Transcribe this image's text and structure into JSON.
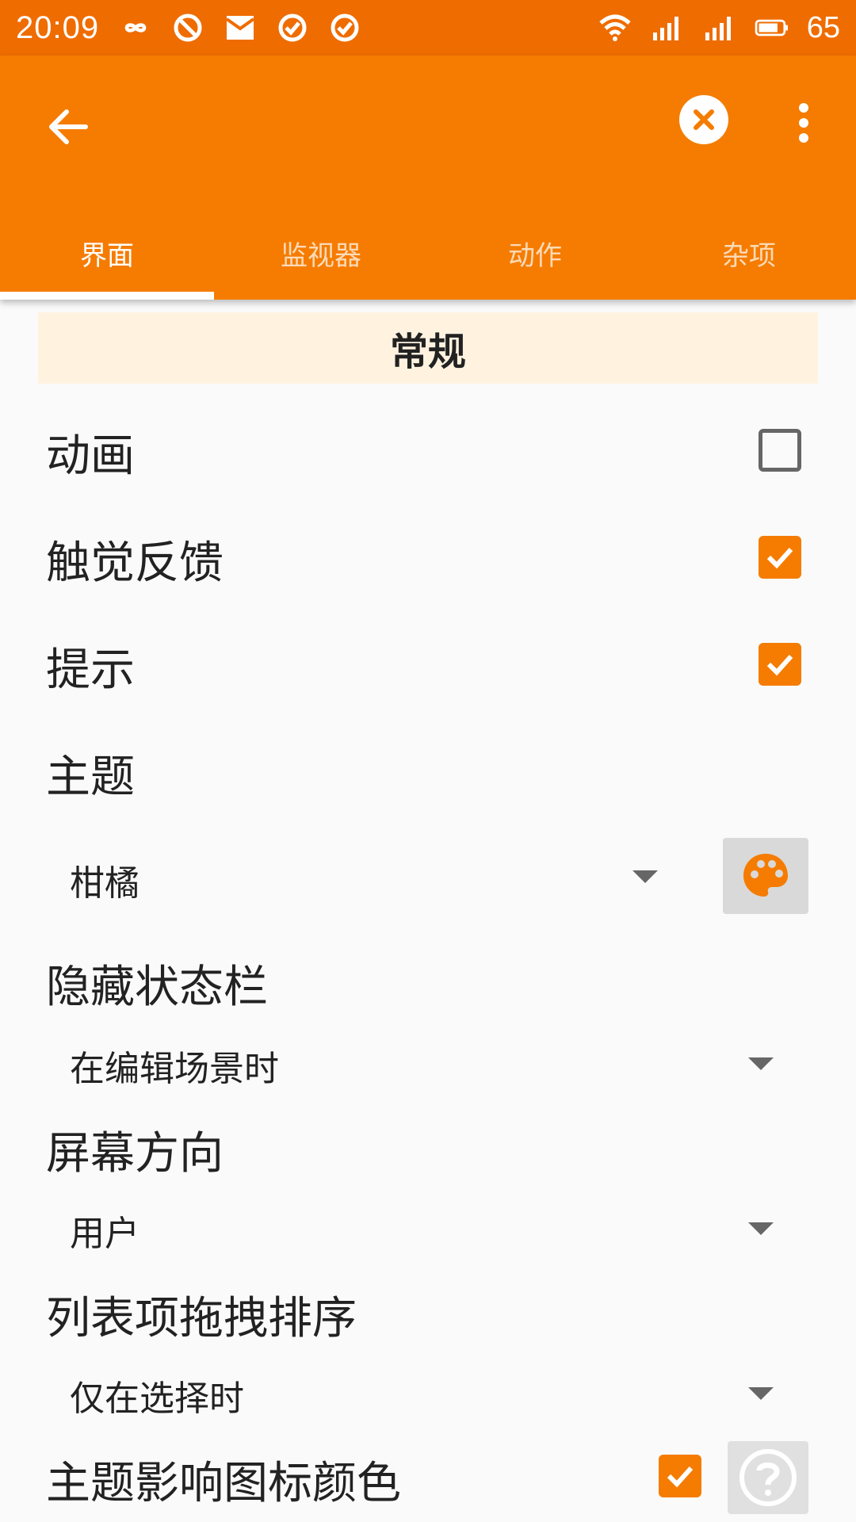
{
  "status_bar": {
    "time": "20:09",
    "left_icons": [
      "infinity-icon",
      "blocked-icon",
      "mail-icon",
      "check-circle-icon",
      "check-circle-icon"
    ],
    "right_icons": [
      "wifi-icon",
      "signal-4g-icon",
      "signal-icon",
      "battery-icon"
    ],
    "battery": "65"
  },
  "app_bar": {
    "back_icon": "arrow-back-icon",
    "close_icon": "close-circle-icon",
    "more_icon": "more-vert-icon",
    "tabs": [
      {
        "label": "界面",
        "active": true
      },
      {
        "label": "监视器",
        "active": false
      },
      {
        "label": "动作",
        "active": false
      },
      {
        "label": "杂项",
        "active": false
      }
    ]
  },
  "section": {
    "title": "常规"
  },
  "settings": {
    "animation": {
      "label": "动画",
      "checked": false
    },
    "haptic": {
      "label": "触觉反馈",
      "checked": true
    },
    "hints": {
      "label": "提示",
      "checked": true
    },
    "theme": {
      "label": "主题",
      "value": "柑橘"
    },
    "hide_status_bar": {
      "label": "隐藏状态栏",
      "value": "在编辑场景时"
    },
    "orientation": {
      "label": "屏幕方向",
      "value": "用户"
    },
    "drag_sort": {
      "label": "列表项拖拽排序",
      "value": "仅在选择时"
    },
    "theme_icon_color": {
      "label": "主题影响图标颜色",
      "checked": true
    }
  },
  "colors": {
    "status_bar": "#ef6c00",
    "app_bar": "#f57c00",
    "accent": "#f57c00",
    "section_bg": "#fff3e0"
  }
}
